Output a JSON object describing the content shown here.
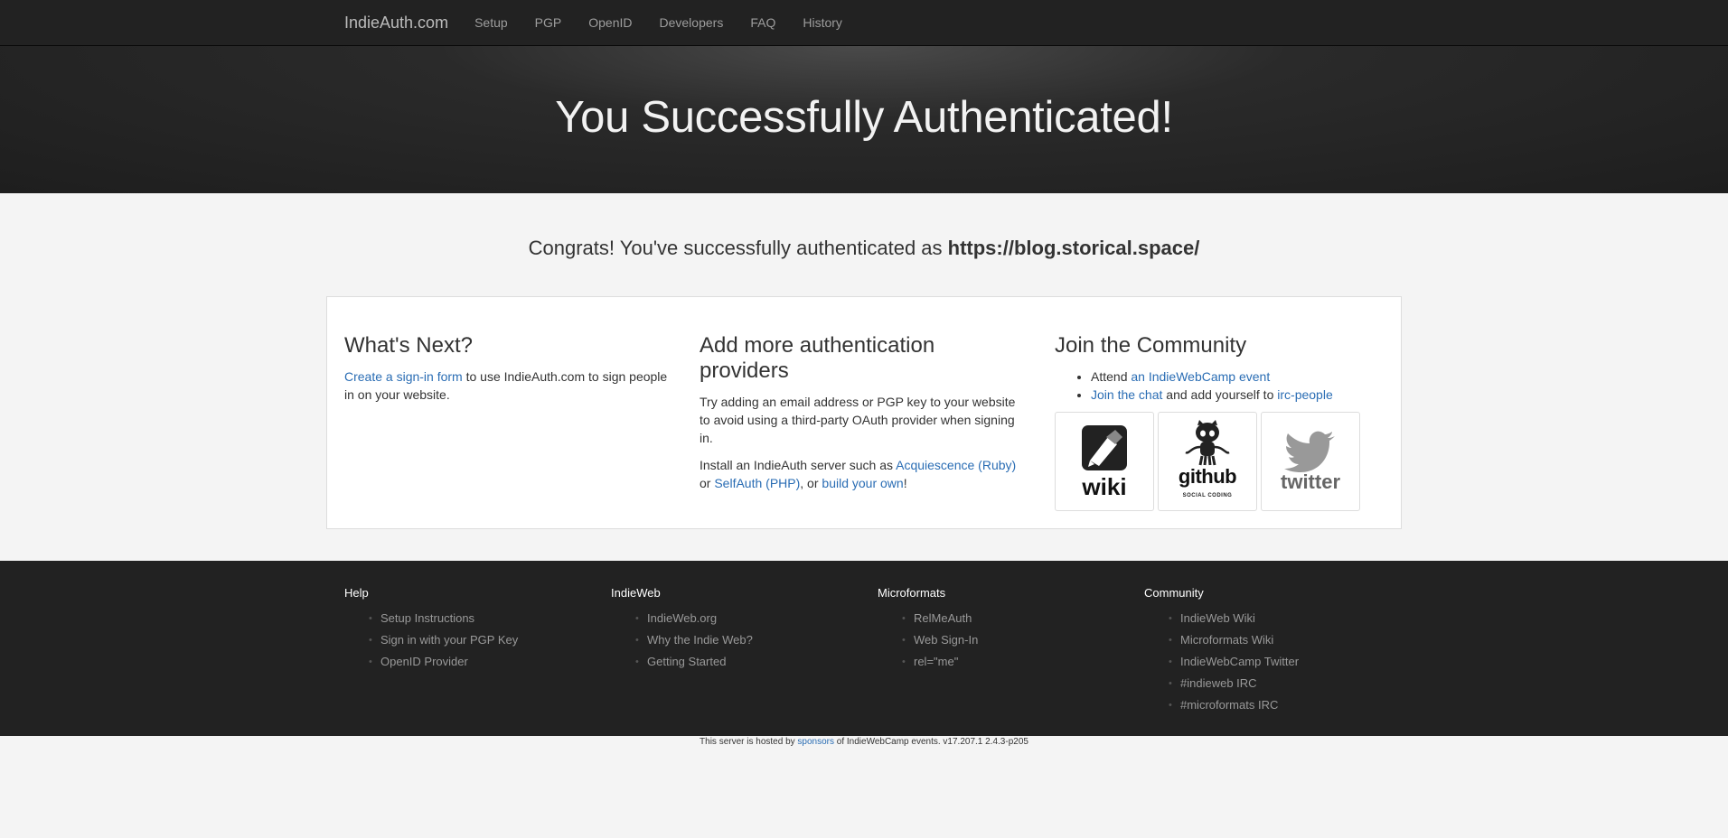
{
  "nav": {
    "brand": "IndieAuth.com",
    "items": [
      "Setup",
      "PGP",
      "OpenID",
      "Developers",
      "FAQ",
      "History"
    ]
  },
  "hero": {
    "title": "You Successfully Authenticated!"
  },
  "congrats": {
    "prefix": "Congrats! You've successfully authenticated as ",
    "url": "https://blog.storical.space/"
  },
  "whats_next": {
    "title": "What's Next?",
    "link": "Create a sign-in form",
    "text": " to use IndieAuth.com to sign people in on your website."
  },
  "providers": {
    "title": "Add more authentication providers",
    "p1": "Try adding an email address or PGP key to your website to avoid using a third-party OAuth provider when signing in.",
    "p2_prefix": "Install an IndieAuth server such as ",
    "link1": "Acquiescence (Ruby)",
    "p2_or": " or ",
    "link2": "SelfAuth (PHP)",
    "p2_comma": ", or ",
    "link3": "build your own",
    "p2_end": "!"
  },
  "community": {
    "title": "Join the Community",
    "item1_prefix": "Attend ",
    "item1_link": "an IndieWebCamp event",
    "item2_link": "Join the chat",
    "item2_mid": " and add yourself to ",
    "item2_link2": "irc-people",
    "logos": {
      "wiki": "wiki",
      "github": "github",
      "github_sub": "SOCIAL CODING",
      "twitter": "twitter"
    }
  },
  "footer": {
    "columns": [
      {
        "title": "Help",
        "items": [
          "Setup Instructions",
          "Sign in with your PGP Key",
          "OpenID Provider"
        ]
      },
      {
        "title": "IndieWeb",
        "items": [
          "IndieWeb.org",
          "Why the Indie Web?",
          "Getting Started"
        ]
      },
      {
        "title": "Microformats",
        "items": [
          "RelMeAuth",
          "Web Sign-In",
          "rel=\"me\""
        ]
      },
      {
        "title": "Community",
        "items": [
          "IndieWeb Wiki",
          "Microformats Wiki",
          "IndieWebCamp Twitter",
          "#indieweb IRC",
          "#microformats IRC"
        ]
      }
    ],
    "bottom_prefix": "This server is hosted by ",
    "bottom_link": "sponsors",
    "bottom_suffix": " of IndieWebCamp events. v17.207.1 2.4.3-p205"
  }
}
